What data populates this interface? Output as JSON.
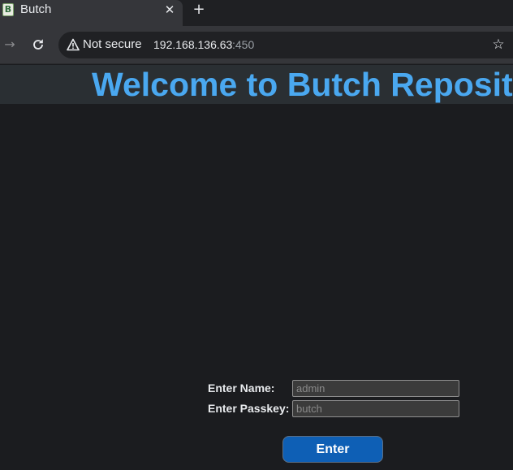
{
  "browser": {
    "tab": {
      "favicon_letter": "B",
      "title": "Butch",
      "close_glyph": "✕"
    },
    "new_tab_glyph": "+",
    "toolbar": {
      "forward_glyph": "→",
      "security_label": "Not secure",
      "url_host": "192.168.136.63",
      "url_port": ":450",
      "bookmark_glyph": "☆"
    }
  },
  "page": {
    "banner_title": "Welcome to Butch Repository",
    "form": {
      "name_label": "Enter Name:",
      "name_placeholder": "admin",
      "passkey_label": "Enter Passkey:",
      "passkey_placeholder": "butch",
      "submit_label": "Enter"
    }
  },
  "colors": {
    "page_background": "#1b1c1f",
    "banner_background": "#2a2f33",
    "title_color": "#4aa8f0",
    "button_color": "#0e5fb5"
  },
  "icons": {
    "favicon": "butch-favicon-icon",
    "tab_close": "close-icon",
    "new_tab": "plus-icon",
    "forward": "forward-arrow-icon",
    "reload": "reload-icon",
    "security": "warning-triangle-icon",
    "bookmark": "star-icon"
  }
}
